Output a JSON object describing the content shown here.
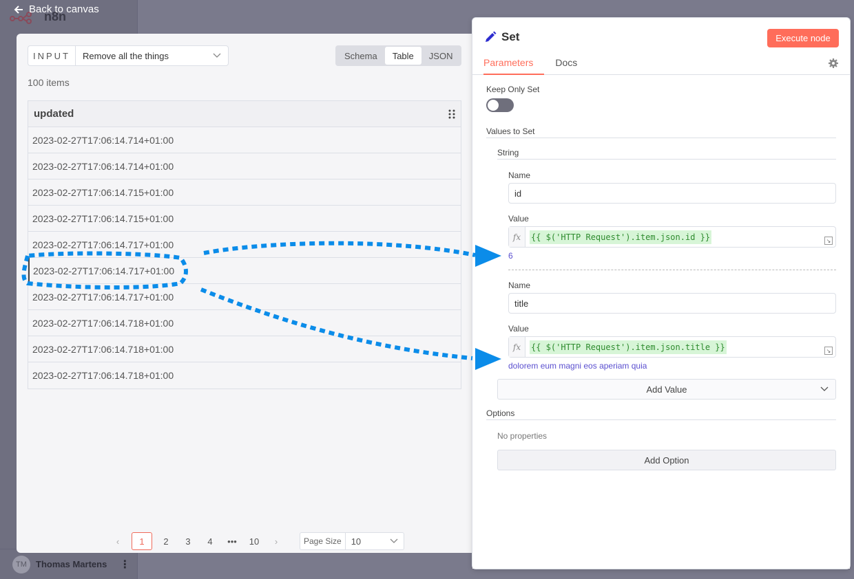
{
  "app": {
    "logo_text": "n8n"
  },
  "nav": {
    "back_label": "Back to canvas"
  },
  "user": {
    "initials": "TM",
    "name": "Thomas Martens"
  },
  "input_panel": {
    "label": "INPUT",
    "selected_node": "Remove all the things",
    "view_tabs": [
      "Schema",
      "Table",
      "JSON"
    ],
    "active_view": "Table",
    "items_count": "100 items",
    "column_header": "updated",
    "rows": [
      "2023-02-27T17:06:14.714+01:00",
      "2023-02-27T17:06:14.714+01:00",
      "2023-02-27T17:06:14.715+01:00",
      "2023-02-27T17:06:14.715+01:00",
      "2023-02-27T17:06:14.717+01:00",
      "2023-02-27T17:06:14.717+01:00",
      "2023-02-27T17:06:14.717+01:00",
      "2023-02-27T17:06:14.718+01:00",
      "2023-02-27T17:06:14.718+01:00",
      "2023-02-27T17:06:14.718+01:00"
    ],
    "pagination": {
      "pages": [
        "1",
        "2",
        "3",
        "4",
        "•••",
        "10"
      ],
      "current": "1",
      "page_size_label": "Page Size",
      "page_size_value": "10"
    }
  },
  "node_panel": {
    "title": "Set",
    "execute_label": "Execute node",
    "tabs": [
      "Parameters",
      "Docs"
    ],
    "keep_only_set_label": "Keep Only Set",
    "keep_only_set_value": false,
    "values_to_set_label": "Values to Set",
    "string_label": "String",
    "entries": [
      {
        "name_label": "Name",
        "name": "id",
        "value_label": "Value",
        "expression": "{{ $('HTTP Request').item.json.id }}",
        "result": "6"
      },
      {
        "name_label": "Name",
        "name": "title",
        "value_label": "Value",
        "expression": "{{ $('HTTP Request').item.json.title }}",
        "result": "dolorem eum magni eos aperiam quia"
      }
    ],
    "add_value_label": "Add Value",
    "options_label": "Options",
    "no_properties": "No properties",
    "add_option_label": "Add Option"
  },
  "colors": {
    "accent": "#ff6d5a",
    "annotation": "#0b8ce9",
    "result": "#5a4fcf"
  }
}
